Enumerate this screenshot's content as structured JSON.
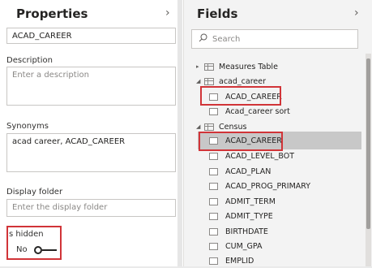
{
  "properties": {
    "title": "Properties",
    "name_value": "ACAD_CAREER",
    "description_label": "Description",
    "description_placeholder": "Enter a description",
    "synonyms_label": "Synonyms",
    "synonyms_value": "acad career, ACAD_CAREER",
    "display_folder_label": "Display folder",
    "display_folder_placeholder": "Enter the display folder",
    "is_hidden_label": "Is hidden",
    "is_hidden_value": "No"
  },
  "fields": {
    "title": "Fields",
    "search_placeholder": "Search",
    "tables": [
      {
        "name": "Measures Table",
        "expanded": false
      },
      {
        "name": "acad_career",
        "expanded": true,
        "items": [
          "ACAD_CAREER",
          "Acad_career sort"
        ]
      },
      {
        "name": "Census",
        "expanded": true,
        "items": [
          "ACAD_CAREER",
          "ACAD_LEVEL_BOT",
          "ACAD_PLAN",
          "ACAD_PROG_PRIMARY",
          "ADMIT_TERM",
          "ADMIT_TYPE",
          "BIRTHDATE",
          "CUM_GPA",
          "EMPLID"
        ]
      }
    ]
  },
  "colors": {
    "highlight": "#d13438",
    "selected_row": "#c8c8c8"
  }
}
